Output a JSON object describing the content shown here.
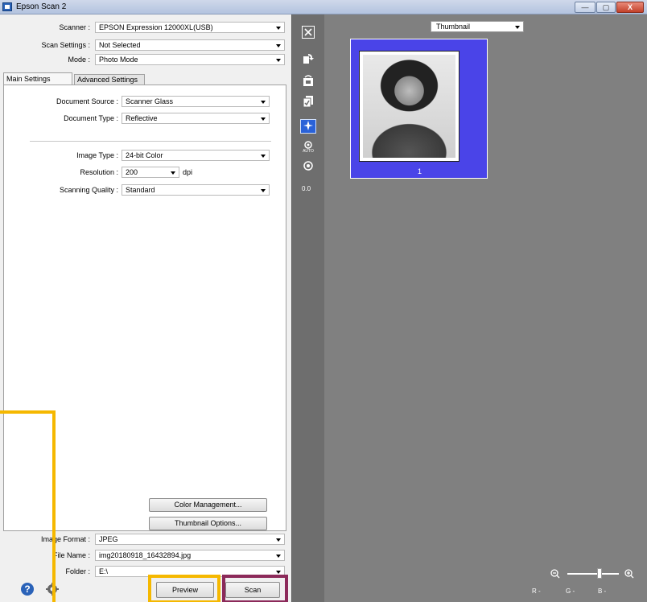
{
  "window": {
    "title": "Epson Scan 2",
    "minimize": "—",
    "maximize": "▢",
    "close": "X"
  },
  "top": {
    "scanner_label": "Scanner :",
    "scanner_value": "EPSON Expression 12000XL(USB)",
    "settings_label": "Scan Settings :",
    "settings_value": "Not Selected",
    "mode_label": "Mode :",
    "mode_value": "Photo Mode"
  },
  "tabs": {
    "main": "Main Settings",
    "advanced": "Advanced Settings"
  },
  "main": {
    "doc_source_label": "Document Source :",
    "doc_source_value": "Scanner Glass",
    "doc_type_label": "Document Type :",
    "doc_type_value": "Reflective",
    "image_type_label": "Image Type :",
    "image_type_value": "24-bit Color",
    "resolution_label": "Resolution :",
    "resolution_value": "200",
    "resolution_unit": "dpi",
    "quality_label": "Scanning Quality :",
    "quality_value": "Standard",
    "color_mgmt_button": "Color Management...",
    "thumb_options_button": "Thumbnail Options..."
  },
  "output": {
    "format_label": "Image Format :",
    "format_value": "JPEG",
    "filename_label": "File Name :",
    "filename_value": "img20180918_16432894.jpg",
    "folder_label": "Folder :",
    "folder_value": "E:\\"
  },
  "actions": {
    "preview": "Preview",
    "scan": "Scan"
  },
  "preview": {
    "view_mode": "Thumbnail",
    "thumbnail_number": "1",
    "rotation_value": "0.0",
    "rgb_r": "R  -",
    "rgb_g": "G  -",
    "rgb_b": "B  -",
    "zoom_level": 0.62
  },
  "colors": {
    "highlight_yellow": "#f5b800",
    "highlight_purple": "#8c2a5a",
    "thumb_blue": "#4a44e8"
  }
}
